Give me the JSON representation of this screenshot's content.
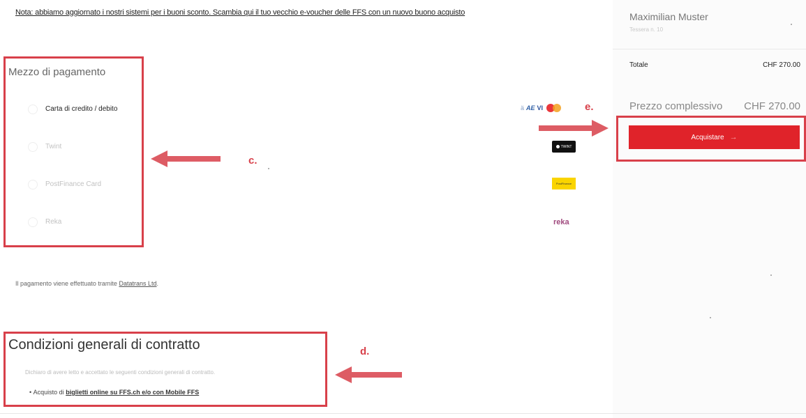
{
  "notice": {
    "text": "Nota: abbiamo aggiornato i nostri sistemi per i buoni sconto. Scambia qui il tuo vecchio e-voucher delle FFS con un nuovo buono acquisto"
  },
  "summary": {
    "customer_name": "Maximilian Muster",
    "customer_detail": "Tessera n. 10",
    "total_label": "Totale",
    "total_value": "CHF 270.00",
    "price_label": "Prezzo complessivo",
    "price_value": "CHF 270.00",
    "buy_label": "Acquistare",
    "buy_arrow": "→"
  },
  "payment": {
    "title": "Mezzo di pagamento",
    "options": [
      {
        "label": "Carta di credito / debito",
        "selected": true,
        "logos": [
          "credit-card-logos-icon"
        ]
      },
      {
        "label": "Twint",
        "selected": false,
        "logos": [
          "twint-logo-icon"
        ]
      },
      {
        "label": "PostFinance Card",
        "selected": false,
        "logos": [
          "postfinance-logo-icon"
        ]
      },
      {
        "label": "Reka",
        "selected": false,
        "logos": [
          "reka-logo-icon"
        ]
      }
    ],
    "logo_texts": {
      "card1": "ä",
      "card2": "AE",
      "card3": "VI",
      "twint": "TWINT",
      "postfinance": "PostFinance",
      "reka": "reka"
    },
    "provider_prefix": "Il pagamento viene effettuato tramite",
    "provider_link": "Datatrans Ltd",
    "provider_suffix": "."
  },
  "terms": {
    "title": "Condizioni generali di contratto",
    "declaration": "Dichiaro di avere letto e accettato le seguenti condizioni generali di contratto.",
    "bullet_prefix": "Acquisto di",
    "bullet_link": "biglietti online su FFS.ch e/o con Mobile FFS"
  },
  "annotations": {
    "c": "c.",
    "d": "d.",
    "e": "e."
  },
  "colors": {
    "accent_red": "#e0232a",
    "annotation_red": "#d8404a"
  }
}
